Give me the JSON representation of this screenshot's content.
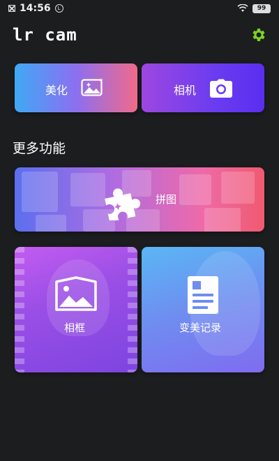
{
  "status_bar": {
    "time": "14:56",
    "badge": "Ⓛ",
    "battery": "99"
  },
  "header": {
    "title": "lr cam"
  },
  "main": {
    "beautify_label": "美化",
    "camera_label": "相机",
    "more_title": "更多功能",
    "collage_label": "拼图",
    "frame_label": "相框",
    "record_label": "变美记录"
  },
  "icons": {
    "settings": "gear-icon",
    "beautify": "image-sparkle-icon",
    "camera": "camera-icon",
    "collage": "puzzle-icon",
    "frame": "picture-frame-icon",
    "record": "document-icon"
  },
  "colors": {
    "settings_icon": "#7ed321",
    "background": "#1c1d1f"
  }
}
